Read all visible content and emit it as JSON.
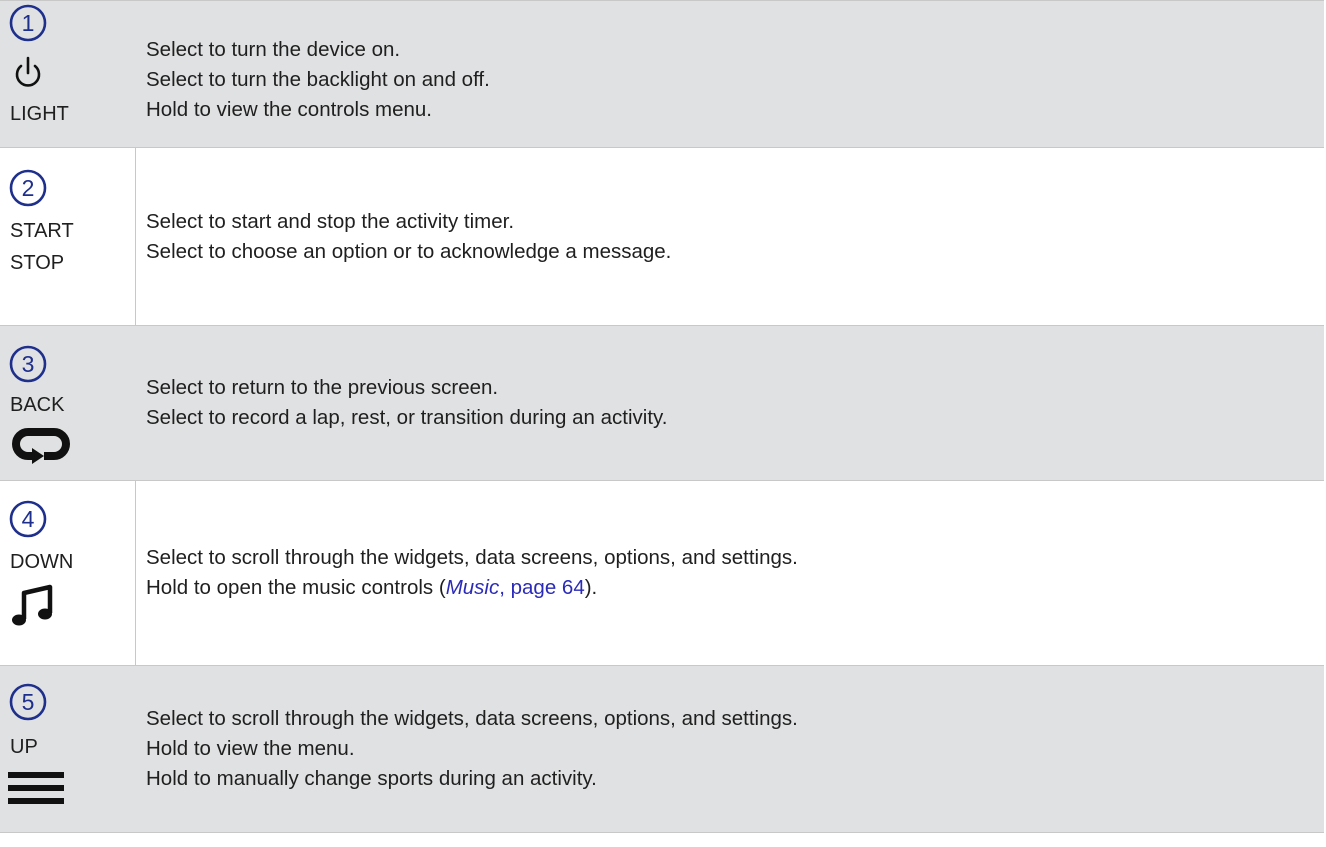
{
  "rows": [
    {
      "number": "1",
      "labels": [
        "LIGHT"
      ],
      "icon": "power-icon",
      "lines": [
        "Select to turn the device on.",
        "Select to turn the backlight on and off.",
        "Hold to view the controls menu."
      ]
    },
    {
      "number": "2",
      "labels": [
        "START",
        "STOP"
      ],
      "lines": [
        "Select to start and stop the activity timer.",
        "Select to choose an option or to acknowledge a message."
      ]
    },
    {
      "number": "3",
      "labels": [
        "BACK"
      ],
      "icon": "lap-loop-icon",
      "lines": [
        "Select to return to the previous screen.",
        "Select to record a lap, rest, or transition during an activity."
      ]
    },
    {
      "number": "4",
      "labels": [
        "DOWN"
      ],
      "icon": "music-note-icon",
      "lines": [
        "Select to scroll through the widgets, data screens, options, and settings."
      ],
      "line_with_link": {
        "before": "Hold to open the music controls (",
        "link_italic": "Music",
        "link_rest": ", page 64",
        "after": ")."
      }
    },
    {
      "number": "5",
      "labels": [
        "UP"
      ],
      "icon": "menu-icon",
      "lines": [
        "Select to scroll through the widgets, data screens, options, and settings.",
        "Hold to view the menu.",
        "Hold to manually change sports during an activity."
      ]
    }
  ],
  "colors": {
    "accent": "#1e2f8c",
    "shaded_row": "#e0e1e2",
    "link": "#2b2bb8"
  }
}
